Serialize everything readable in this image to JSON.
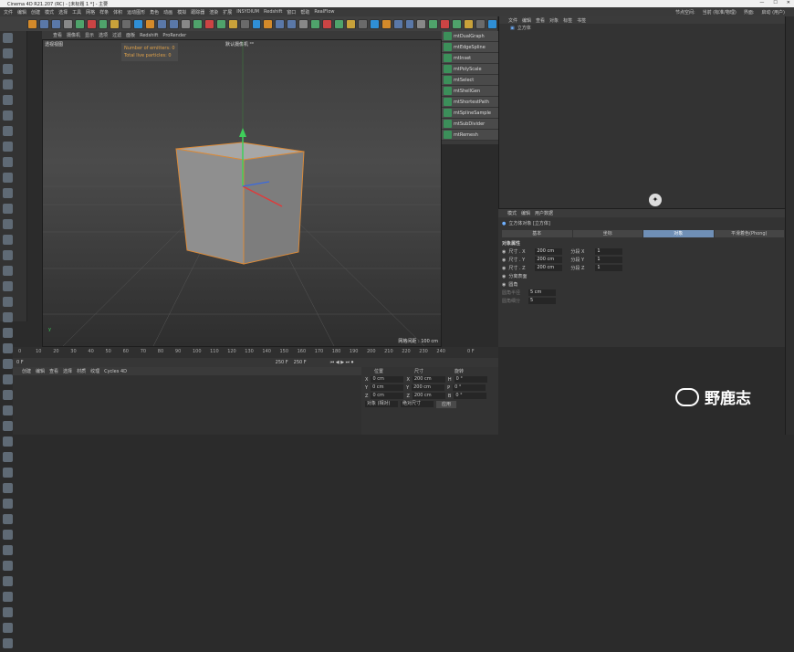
{
  "window": {
    "title": "Cinema 4D R21.207 (RC) - [未标题 1 *] - 主要"
  },
  "menu": {
    "items": [
      "文件",
      "编辑",
      "创建",
      "模式",
      "选择",
      "工具",
      "网格",
      "样条",
      "体积",
      "运动图形",
      "角色",
      "动画",
      "模拟",
      "跟踪器",
      "渲染",
      "扩展",
      "INSYDIUM",
      "Redshift",
      "窗口",
      "帮助",
      "RealFlow"
    ],
    "right": [
      "节点空间:",
      "当前 (标准/物理)",
      "界面:",
      "启动 (用户)"
    ]
  },
  "viewport": {
    "menu": [
      "查看",
      "摄像机",
      "显示",
      "选项",
      "过滤",
      "面板",
      "Redshift",
      "ProRender"
    ],
    "view_name": "透视视图",
    "camera": "默认摄像机 ⁰°",
    "stats": [
      "Number of emitters: 0",
      "Total live particles: 0"
    ],
    "grid": "网格间距 : 100 cm"
  },
  "plugins": [
    "mtDualGraph",
    "mtEdgeSpline",
    "mtInset",
    "mtPolyScale",
    "mtSelect",
    "mtShellGen",
    "mtShortestPath",
    "mtSplineSample",
    "mtSubDivider",
    "mtRemesh"
  ],
  "objects": {
    "menu": [
      "文件",
      "编辑",
      "查看",
      "对象",
      "标签",
      "书签"
    ],
    "items": [
      {
        "name": "立方体"
      }
    ]
  },
  "attributes": {
    "menu": [
      "模式",
      "编辑",
      "用户数据"
    ],
    "object_title": "立方体对象 [立方体]",
    "tabs": [
      "基本",
      "坐标",
      "对象",
      "平滑着色(Phong)"
    ],
    "active_tab": "对象",
    "section": "对象属性",
    "fields": [
      {
        "label": "尺寸 . X",
        "value": "200 cm",
        "seg_label": "分段 X",
        "seg": "1"
      },
      {
        "label": "尺寸 . Y",
        "value": "200 cm",
        "seg_label": "分段 Y",
        "seg": "1"
      },
      {
        "label": "尺寸 . Z",
        "value": "200 cm",
        "seg_label": "分段 Z",
        "seg": "1"
      }
    ],
    "separate": "分离表面",
    "fillet": "圆角",
    "fillet_radius_label": "圆角半径",
    "fillet_radius": "5 cm",
    "fillet_sub_label": "圆角细分",
    "fillet_sub": "5"
  },
  "timeline": {
    "ticks": [
      "0",
      "10",
      "20",
      "30",
      "40",
      "50",
      "60",
      "70",
      "80",
      "90",
      "100",
      "110",
      "120",
      "130",
      "140",
      "150",
      "160",
      "170",
      "180",
      "190",
      "200",
      "210",
      "220",
      "230",
      "240"
    ],
    "current": "0 F",
    "start": "0 F",
    "end1": "250 F",
    "end2": "250 F",
    "right_label": "0 F"
  },
  "materials": {
    "menu": [
      "创建",
      "编辑",
      "查看",
      "选择",
      "材质",
      "纹理",
      "Cycles 4D"
    ]
  },
  "coords": {
    "headers": [
      "位置",
      "尺寸",
      "旋转"
    ],
    "rows": [
      {
        "a": "X",
        "av": "0 cm",
        "b": "X",
        "bv": "200 cm",
        "c": "H",
        "cv": "0 °"
      },
      {
        "a": "Y",
        "av": "0 cm",
        "b": "Y",
        "bv": "200 cm",
        "c": "P",
        "cv": "0 °"
      },
      {
        "a": "Z",
        "av": "0 cm",
        "b": "Z",
        "bv": "200 cm",
        "c": "B",
        "cv": "0 °"
      }
    ],
    "mode1": "对象 (相对)",
    "mode2": "绝对尺寸",
    "apply": "应用"
  },
  "watermark": "野鹿志"
}
